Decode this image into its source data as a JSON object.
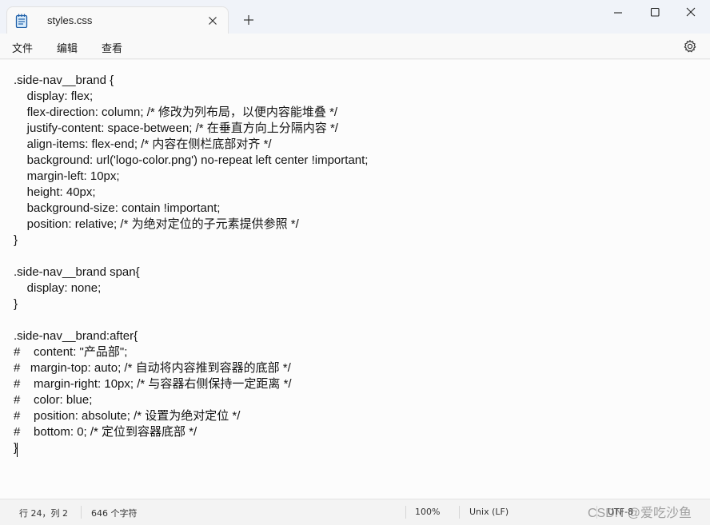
{
  "tab": {
    "title": "styles.css"
  },
  "menu": {
    "file": "文件",
    "edit": "编辑",
    "view": "查看"
  },
  "editor": {
    "lines": [
      ".side-nav__brand {",
      "    display: flex;",
      "    flex-direction: column; /* 修改为列布局，以便内容能堆叠 */",
      "    justify-content: space-between; /* 在垂直方向上分隔内容 */",
      "    align-items: flex-end; /* 内容在侧栏底部对齐 */",
      "    background: url('logo-color.png') no-repeat left center !important;",
      "    margin-left: 10px;",
      "    height: 40px;",
      "    background-size: contain !important;",
      "    position: relative; /* 为绝对定位的子元素提供参照 */",
      "}",
      "",
      ".side-nav__brand span{",
      "    display: none;",
      "}",
      "",
      ".side-nav__brand:after{",
      "#    content: \"产品部\";",
      "#   margin-top: auto; /* 自动将内容推到容器的底部 */",
      "#    margin-right: 10px; /* 与容器右侧保持一定距离 */",
      "#    color: blue;",
      "#    position: absolute; /* 设置为绝对定位 */",
      "#    bottom: 0; /* 定位到容器底部 */",
      "}"
    ]
  },
  "status": {
    "position": "行 24，列 2",
    "char_count": "646 个字符",
    "zoom": "100%",
    "line_ending": "Unix (LF)",
    "encoding": "UTF-8"
  },
  "watermark": "CSDN @爱吃沙鱼"
}
